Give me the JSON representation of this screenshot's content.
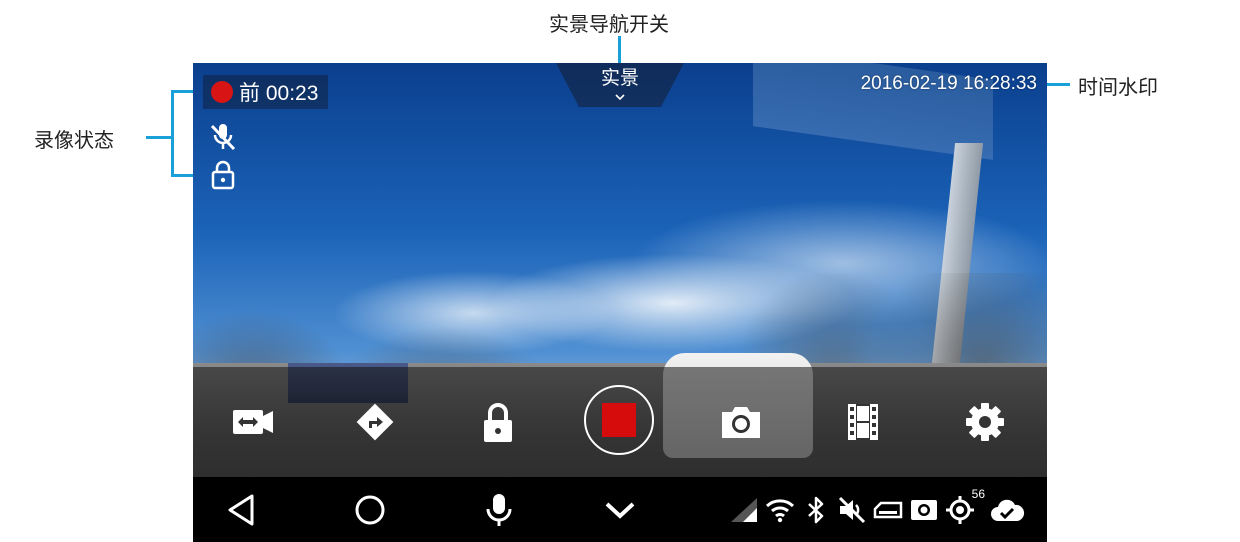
{
  "annotations": {
    "ar_nav_toggle": "实景导航开关",
    "recording_status": "录像状态",
    "time_watermark": "时间水印"
  },
  "screen": {
    "recording": {
      "label": "前 00:23",
      "dot_color": "#d81414"
    },
    "status_icons": [
      "mic-muted-icon",
      "lock-icon"
    ],
    "ar_toggle": {
      "label": "实景",
      "icon": "chevron-down-icon"
    },
    "watermark": "2016-02-19 16:28:33",
    "controls": [
      {
        "name": "switch-camera-button",
        "icon": "camera-switch-icon"
      },
      {
        "name": "navigation-button",
        "icon": "navigation-turn-icon"
      },
      {
        "name": "lock-video-button",
        "icon": "lock-icon"
      },
      {
        "name": "record-button",
        "icon": "stop-icon",
        "color": "#d60b0b"
      },
      {
        "name": "photo-button",
        "icon": "camera-icon"
      },
      {
        "name": "video-list-button",
        "icon": "film-icon"
      },
      {
        "name": "settings-button",
        "icon": "gear-icon"
      }
    ],
    "nav_bar": {
      "buttons": [
        "back-icon",
        "home-icon",
        "voice-icon",
        "collapse-icon"
      ],
      "status_icons": [
        "signal-icon",
        "wifi-icon",
        "bluetooth-icon",
        "mute-icon",
        "sd-card-icon",
        "camera-status-icon",
        "gps-icon",
        "cloud-sync-icon"
      ],
      "gps_count": "56"
    }
  }
}
